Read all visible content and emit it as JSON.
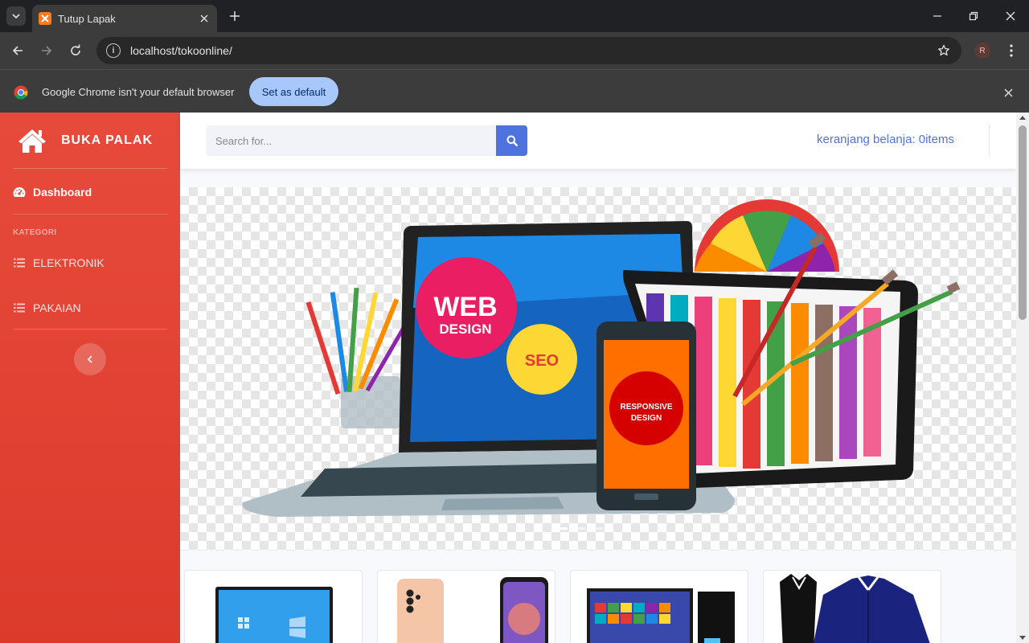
{
  "browser": {
    "tab_title": "Tutup Lapak",
    "url": "localhost/tokoonline/",
    "profile_initial": "R",
    "infobar_message": "Google Chrome isn't your default browser",
    "infobar_button": "Set as default"
  },
  "sidebar": {
    "brand": "BUKA PALAK",
    "dashboard_label": "Dashboard",
    "heading": "KATEGORI",
    "items": [
      {
        "label": "ELEKTRONIK"
      },
      {
        "label": "PAKAIAN"
      }
    ]
  },
  "topbar": {
    "search_placeholder": "Search for...",
    "cart_text": "keranjang belanja: 0items"
  },
  "hero": {
    "laptop_text_1": "WEB",
    "laptop_text_2": "DESIGN",
    "seo_text": "SEO",
    "phone_text_1": "RESPONSIVE",
    "phone_text_2": "DESIGN"
  },
  "colors": {
    "sidebar": "#e74a3b",
    "primary": "#4e73df",
    "chrome_dark": "#202124",
    "chrome_toolbar": "#3c3c3c"
  },
  "icons": {
    "brand": "home-icon",
    "dashboard": "tachometer-icon",
    "category": "list-icon",
    "search": "search-icon",
    "toggle": "chevron-left-icon"
  }
}
